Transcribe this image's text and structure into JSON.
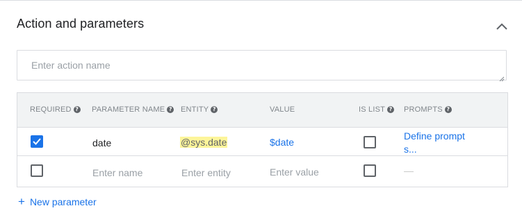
{
  "section": {
    "title": "Action and parameters",
    "collapse_icon": "chevron-up-icon"
  },
  "action": {
    "placeholder": "Enter action name",
    "value": ""
  },
  "table": {
    "headers": {
      "required": "REQUIRED",
      "parameter_name": "PARAMETER NAME",
      "entity": "ENTITY",
      "value": "VALUE",
      "is_list": "IS LIST",
      "prompts": "PROMPTS"
    },
    "help_icon": "help-circle-icon",
    "rows": [
      {
        "required": true,
        "name": "date",
        "entity": "@sys.date",
        "value": "$date",
        "is_list": false,
        "prompts_line1": "Define prompt",
        "prompts_line2": "s..."
      },
      {
        "required": false,
        "name_placeholder": "Enter name",
        "entity_placeholder": "Enter entity",
        "value_placeholder": "Enter value",
        "is_list": false,
        "prompts": "—"
      }
    ]
  },
  "new_parameter": {
    "icon": "plus-icon",
    "label": "New parameter"
  },
  "colors": {
    "accent": "#1a73e8",
    "entity_highlight": "#fdf59a",
    "header_bg": "#f1f3f4"
  }
}
